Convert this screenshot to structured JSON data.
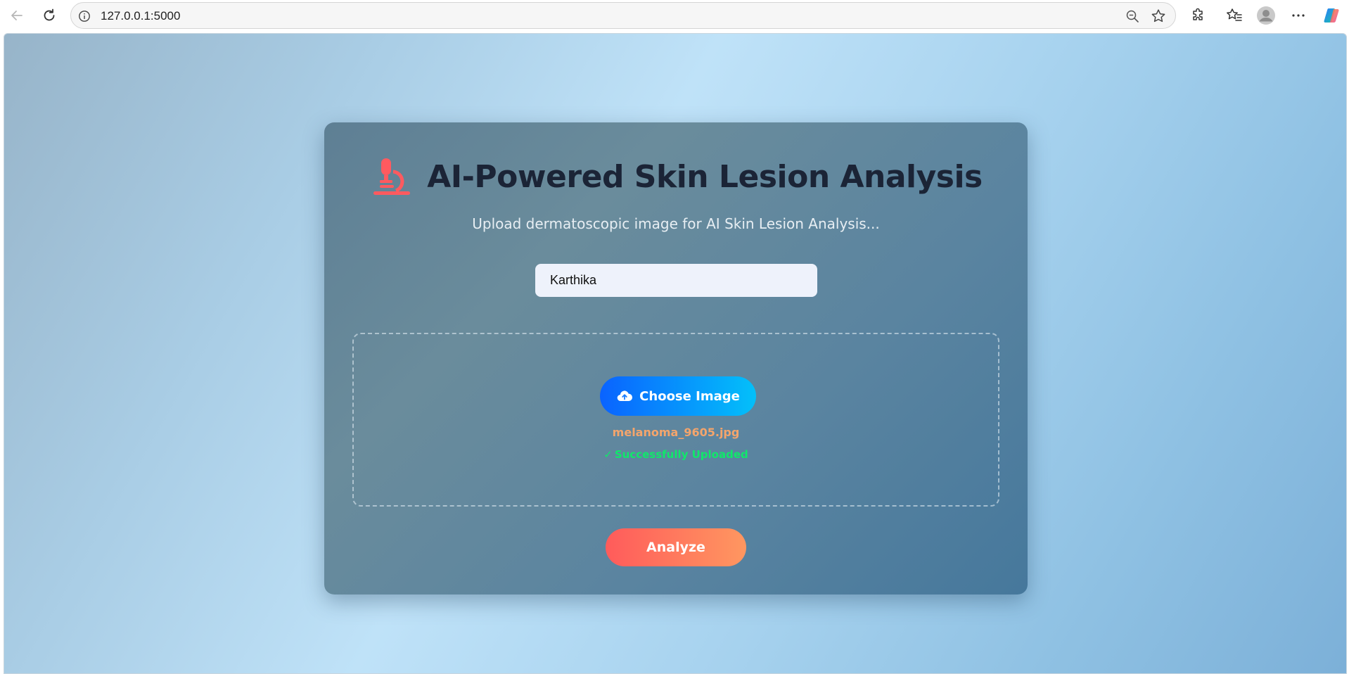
{
  "browser": {
    "url": "127.0.0.1:5000",
    "icons": {
      "back": "back-arrow-icon",
      "reload": "reload-icon",
      "info": "info-icon",
      "zoom": "zoom-out-icon",
      "favorite": "star-icon",
      "extensions": "puzzle-icon",
      "favorites": "favorites-icon",
      "profile": "profile-avatar-icon",
      "menu": "more-icon",
      "copilot": "copilot-icon"
    }
  },
  "page": {
    "title": "AI-Powered Skin Lesion Analysis",
    "title_icon": "microscope-icon",
    "subtitle": "Upload dermatoscopic image for AI Skin Lesion Analysis...",
    "name_input": {
      "value": "Karthika"
    },
    "upload": {
      "button_label": "Choose Image",
      "button_icon": "cloud-upload-icon",
      "file_name": "melanoma_9605.jpg",
      "status_check": "✓",
      "status_text": "Successfully Uploaded"
    },
    "analyze_label": "Analyze"
  },
  "colors": {
    "title": "#1b2436",
    "microscope": "#ff5a5f",
    "choose_gradient_start": "#0a63ff",
    "choose_gradient_end": "#03c0fa",
    "analyze_gradient_start": "#ff5b5b",
    "analyze_gradient_end": "#ff9760",
    "file_name": "#f4a56c",
    "success": "#10e86a"
  }
}
